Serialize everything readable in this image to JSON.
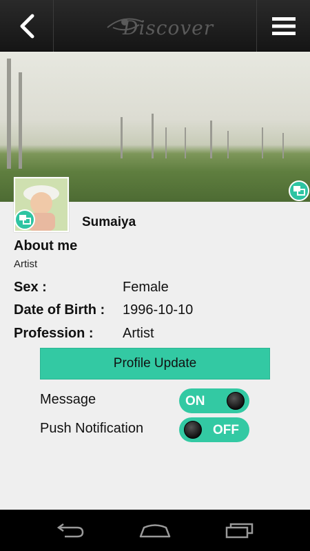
{
  "header": {
    "logo_text": "Discover",
    "back_icon": "chevron-left-icon",
    "menu_icon": "hamburger-menu-icon"
  },
  "profile": {
    "name": "Sumaiya",
    "about_title": "About me",
    "about_text": "Artist"
  },
  "info": [
    {
      "label": "Sex :",
      "value": "Female"
    },
    {
      "label": "Date of Birth :",
      "value": "1996-10-10"
    },
    {
      "label": "Profession :",
      "value": "Artist"
    }
  ],
  "actions": {
    "update_label": "Profile Update"
  },
  "settings": [
    {
      "label": "Message",
      "state": "ON"
    },
    {
      "label": "Push Notification",
      "state": "OFF"
    }
  ],
  "colors": {
    "accent": "#33c9a3",
    "topbar": "#1e1e1e",
    "navbar": "#000000"
  }
}
